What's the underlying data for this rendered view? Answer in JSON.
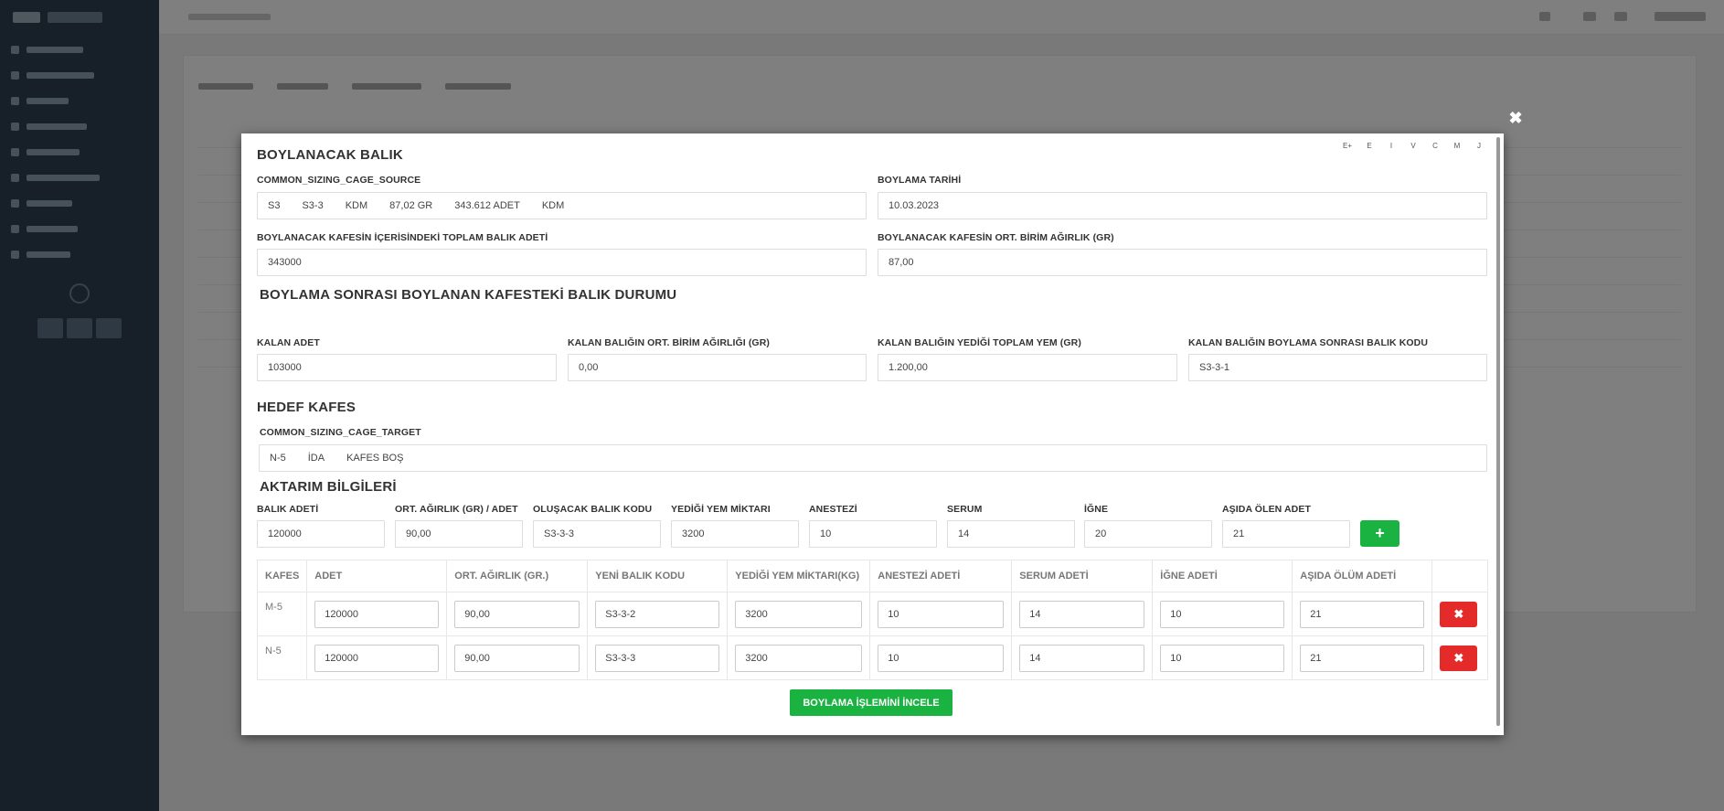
{
  "modal": {
    "format_bar": [
      "E+",
      "E",
      "I",
      "V",
      "C",
      "M",
      "J"
    ],
    "close_icon": "✖",
    "source_section": {
      "title": "BOYLANACAK BALIK",
      "source_label": "COMMON_SIZING_CAGE_SOURCE",
      "source_parts": [
        "S3",
        "S3-3",
        "KDM",
        "87,02 GR",
        "343.612 ADET",
        "KDM"
      ],
      "date_label": "BOYLAMA TARİHİ",
      "date_value": "10.03.2023",
      "total_label": "BOYLANACAK KAFESİN İÇERİSİNDEKİ TOPLAM BALIK ADETİ",
      "total_value": "343000",
      "avg_label": "BOYLANACAK KAFESİN ORT. BİRİM AĞIRLIK (GR)",
      "avg_value": "87,00"
    },
    "after_section": {
      "title": "BOYLAMA SONRASI BOYLANAN KAFESTEKİ BALIK DURUMU",
      "remaining_label": "KALAN ADET",
      "remaining_value": "103000",
      "remaining_avg_label": "KALAN BALIĞIN ORT. BİRİM AĞIRLIĞI (GR)",
      "remaining_avg_value": "0,00",
      "feed_label": "KALAN BALIĞIN YEDİĞİ TOPLAM YEM (GR)",
      "feed_value": "1.200,00",
      "code_label": "KALAN BALIĞIN BOYLAMA SONRASI BALIK KODU",
      "code_value": "S3-3-1"
    },
    "target_section": {
      "title": "HEDEF KAFES",
      "target_label": "COMMON_SIZING_CAGE_TARGET",
      "target_parts": [
        "N-5",
        "İDA",
        "KAFES BOŞ"
      ]
    },
    "transfer_section": {
      "title": "AKTARIM BİLGİLERİ",
      "fields": [
        {
          "label": "BALIK ADETİ",
          "value": "120000"
        },
        {
          "label": "ORT. AĞIRLIK (GR) / ADET",
          "value": "90,00"
        },
        {
          "label": "OLUŞACAK BALIK KODU",
          "value": "S3-3-3"
        },
        {
          "label": "YEDİĞİ YEM MİKTARI",
          "value": "3200"
        },
        {
          "label": "ANESTEZİ",
          "value": "10"
        },
        {
          "label": "SERUM",
          "value": "14"
        },
        {
          "label": "İĞNE",
          "value": "20"
        },
        {
          "label": "AŞIDA ÖLEN ADET",
          "value": "21"
        }
      ],
      "add_icon": "+"
    },
    "table": {
      "headers": [
        "KAFES",
        "ADET",
        "ORT. AĞIRLIK (GR.)",
        "YENİ BALIK KODU",
        "YEDİĞİ YEM MİKTARI(KG)",
        "ANESTEZİ ADETİ",
        "SERUM ADETİ",
        "İĞNE ADETİ",
        "AŞIDA ÖLÜM ADETİ",
        ""
      ],
      "rows": [
        {
          "kafes": "M-5",
          "adet": "120000",
          "ort": "90,00",
          "kod": "S3-3-2",
          "yem": "3200",
          "anestezi": "10",
          "serum": "14",
          "igne": "10",
          "olum": "21"
        },
        {
          "kafes": "N-5",
          "adet": "120000",
          "ort": "90,00",
          "kod": "S3-3-3",
          "yem": "3200",
          "anestezi": "10",
          "serum": "14",
          "igne": "10",
          "olum": "21"
        }
      ],
      "delete_icon": "✖"
    },
    "review_button": "BOYLAMA İŞLEMİNİ İNCELE"
  }
}
